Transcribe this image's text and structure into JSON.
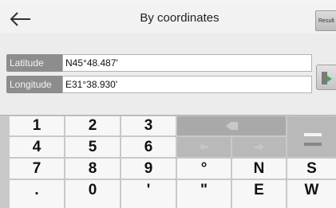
{
  "header": {
    "title": "By coordinates",
    "back_icon": "arrow-left-icon",
    "result_label": "Result"
  },
  "fields": {
    "latitude": {
      "label": "Latitude",
      "value": "N45°48.487'"
    },
    "longitude": {
      "label": "Longitude",
      "value": "E31°38.930'"
    }
  },
  "go_button": {
    "icon": "go-arrow-icon",
    "accent": "#3fae49"
  },
  "keyboard": {
    "row1": [
      "1",
      "2",
      "3"
    ],
    "row2": [
      "4",
      "5",
      "6"
    ],
    "row3": [
      "7",
      "8",
      "9",
      "°",
      "N",
      "S"
    ],
    "row4": [
      ".",
      "0",
      "'",
      "\"",
      "E",
      "W"
    ],
    "backspace_icon": "backspace-icon",
    "left_icon": "cursor-left-icon",
    "right_icon": "cursor-right-icon",
    "enter_icon": "enter-icon"
  }
}
